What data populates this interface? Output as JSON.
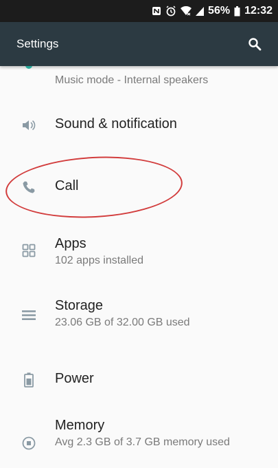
{
  "status_bar": {
    "battery": "56%",
    "time": "12:32",
    "icons": [
      "nfc-icon",
      "alarm-icon",
      "wifi-icon",
      "signal-icon",
      "battery-icon"
    ]
  },
  "app_bar": {
    "title": "Settings",
    "search_icon": "search-icon"
  },
  "settings": {
    "partial_item": {
      "subtitle": "Music mode - Internal speakers"
    },
    "sound": {
      "label": "Sound & notification",
      "icon": "volume-icon"
    },
    "call": {
      "label": "Call",
      "icon": "phone-icon"
    },
    "apps": {
      "label": "Apps",
      "subtitle": "102 apps installed",
      "icon": "apps-grid-icon"
    },
    "storage": {
      "label": "Storage",
      "subtitle": "23.06 GB of 32.00 GB used",
      "icon": "storage-icon"
    },
    "power": {
      "label": "Power",
      "icon": "battery-icon"
    },
    "memory": {
      "label": "Memory",
      "subtitle": "Avg 2.3 GB of 3.7 GB memory used",
      "icon": "memory-icon"
    }
  },
  "colors": {
    "status_bar_bg": "#1c1c1c",
    "app_bar_bg": "#2c3a42",
    "annotation": "#d23c3c",
    "icon_gray": "#8a9aa4",
    "accent_teal": "#28a89a"
  }
}
